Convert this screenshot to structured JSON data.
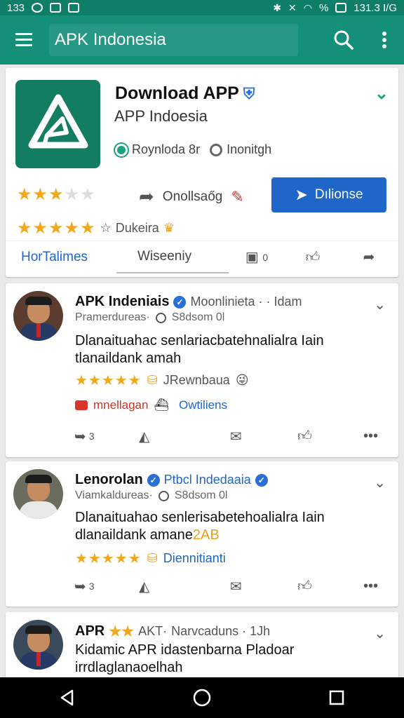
{
  "status_bar": {
    "left_text": "133",
    "right_text": "131.3 I/G",
    "battery": "%"
  },
  "app_bar": {
    "title": "APK Indonesia"
  },
  "app_card": {
    "title": "Download APP",
    "subtitle": "APP Indoesia",
    "meta_left": "Roynloda 8r",
    "meta_right": "Inonitgh",
    "share_label": "Onollsaőg",
    "install_label": "Dılionse",
    "rating_label": "Dukeira",
    "tabs": [
      "HorTalimes",
      "Wiseeniy",
      "0"
    ],
    "colors": {
      "accent": "#149079",
      "button": "#1f66c8",
      "stars": "#f2a81d"
    }
  },
  "posts": [
    {
      "name": "APK Indeniais",
      "name_extra": "Moonlinieta · · Idam",
      "meta_left": "Pramerdureas·",
      "meta_right": "S8dsom 0l",
      "text": "Dlanaituahac senlariacbatehnalialra Iain tlanaildank amah",
      "rating_label": "JRewnbaua",
      "tag_red": "mnellagan",
      "tag_blue": "Owtiliens",
      "share_count": "3"
    },
    {
      "name": "Lenorolan",
      "name_extra": "Ptbcl Indedaaia",
      "meta_left": "Viamkaldureas·",
      "meta_right": "S8dsom 0l",
      "text_line1": "Dlanaituahao senlerisabetehoalialra Iain",
      "text_line2": "dlanaildank amane",
      "text_highlight": "2AB",
      "rating_label": "Diennitianti",
      "share_count": "3"
    },
    {
      "name": "APR",
      "name_extra": "AKT·",
      "meta": "Narvcaduns · 1Jh",
      "text": "Kidamic APR idastenbarna Pladoar irrdlaglanaoelhah"
    }
  ]
}
